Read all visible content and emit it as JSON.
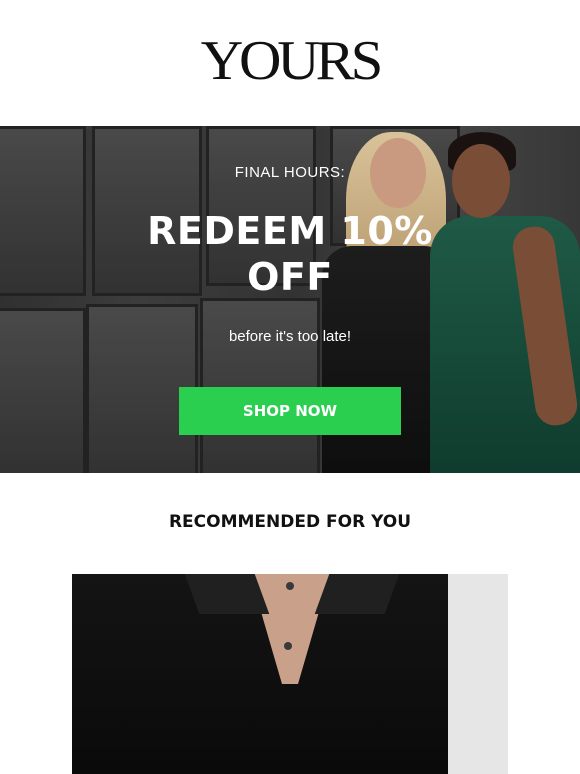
{
  "header": {
    "logo_text": "YOURS"
  },
  "hero": {
    "kicker": "FINAL HOURS:",
    "headline": "REDEEM 10% OFF",
    "subline": "before it's too late!",
    "cta_label": "SHOP NOW",
    "cta_color": "#2bcf4f"
  },
  "recommended": {
    "title": "RECOMMENDED FOR YOU"
  }
}
